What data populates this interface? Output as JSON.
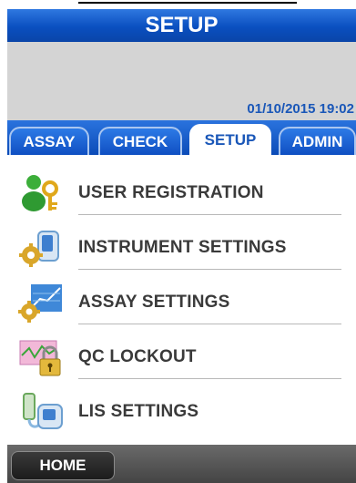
{
  "title": "SETUP",
  "datetime": "01/10/2015 19:02",
  "tabs": [
    {
      "label": "ASSAY",
      "active": false
    },
    {
      "label": "CHECK",
      "active": false
    },
    {
      "label": "SETUP",
      "active": true
    },
    {
      "label": "ADMIN",
      "active": false
    }
  ],
  "menu": [
    {
      "label": "USER REGISTRATION",
      "icon": "user-key-icon"
    },
    {
      "label": "INSTRUMENT SETTINGS",
      "icon": "instrument-gear-icon"
    },
    {
      "label": "ASSAY SETTINGS",
      "icon": "chart-gear-icon"
    },
    {
      "label": "QC LOCKOUT",
      "icon": "padlock-icon"
    },
    {
      "label": "LIS SETTINGS",
      "icon": "lis-device-icon"
    }
  ],
  "home_label": "HOME",
  "colors": {
    "header_blue": "#0a4fc0",
    "datetime_blue": "#1a57b8",
    "menu_text": "#3a3a3a",
    "bottom_bar": "#555555"
  }
}
